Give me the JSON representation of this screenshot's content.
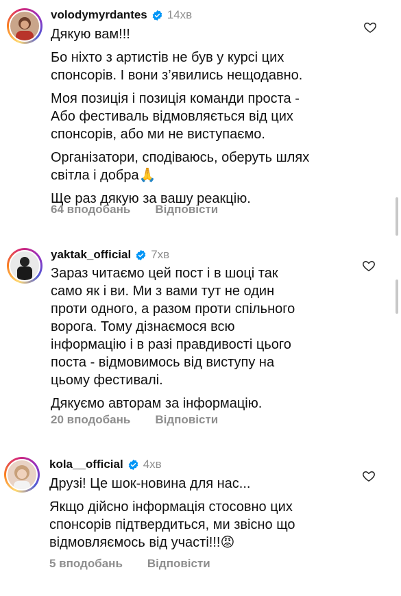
{
  "comments": [
    {
      "username": "volodymyrdantes",
      "time": "14хв",
      "paragraphs": [
        "Дякую вам!!!",
        "Бо ніхто з артистів не був у курсі цих\nспонсорів. І вони з’явились нещодавно.",
        "Моя  позиція і позиція команди проста -\nАбо фестиваль відмовляється від цих\nспонсорів, або ми не виступаємо.",
        "Організатори, сподіваюсь, оберуть шлях\nсвітла і добра🙏",
        "Ще раз дякую за вашу реакцію."
      ],
      "likes": "64 вподобань",
      "reply": "Відповісти"
    },
    {
      "username": "yaktak_official",
      "time": "7хв",
      "paragraphs": [
        "Зараз читаємо цей пост і в шоці так\nсамо як і ви. Ми з вами тут не один\nпроти одного, а разом проти спільного\nворога. Тому дізнаємося всю\nінформацію і в разі правдивості цього\nпоста - відмовимось від виступу на\nцьому фестивалі.",
        "Дякуємо авторам за інформацію."
      ],
      "likes": "20 вподобань",
      "reply": "Відповісти"
    },
    {
      "username": "kola__official",
      "time": "4хв",
      "paragraphs": [
        "Друзі! Це шок-новина для нас...",
        "Якщо дійсно інформація стосовно цих\nспонсорів підтвердиться, ми звісно що\nвідмовляємось від участі!!!😡"
      ],
      "likes": "5 вподобань",
      "reply": "Відповісти"
    }
  ],
  "icons": {
    "verified": "verified-badge-icon",
    "like": "heart-icon"
  },
  "colors": {
    "verified": "#0095f6",
    "secondary_text": "#8e8e8e"
  }
}
